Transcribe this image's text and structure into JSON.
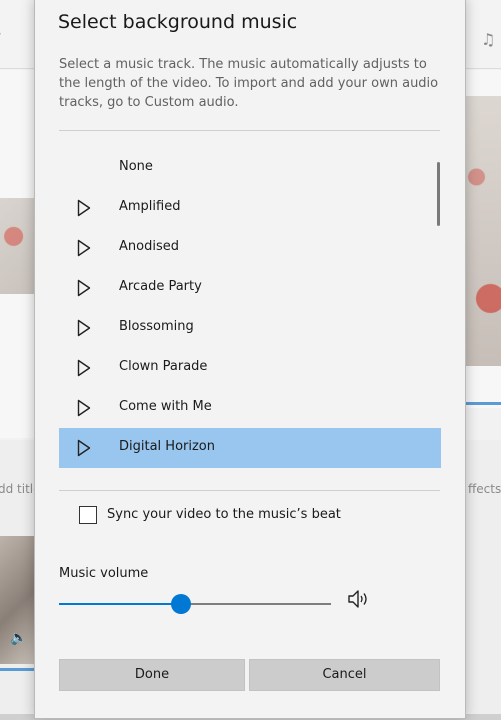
{
  "background": {
    "left_caption": "dd title",
    "right_caption": "ffects",
    "music_icon": "music-note-icon",
    "speaker_icon": "speaker-icon"
  },
  "dialog": {
    "title": "Select background music",
    "description": "Select a music track. The music automatically adjusts to the length of the video. To import and add your own audio tracks, go to Custom audio.",
    "tracks": [
      {
        "name": "None",
        "has_play": false,
        "selected": false
      },
      {
        "name": "Amplified",
        "has_play": true,
        "selected": false
      },
      {
        "name": "Anodised",
        "has_play": true,
        "selected": false
      },
      {
        "name": "Arcade Party",
        "has_play": true,
        "selected": false
      },
      {
        "name": "Blossoming",
        "has_play": true,
        "selected": false
      },
      {
        "name": "Clown Parade",
        "has_play": true,
        "selected": false
      },
      {
        "name": "Come with Me",
        "has_play": true,
        "selected": false
      },
      {
        "name": "Digital Horizon",
        "has_play": true,
        "selected": true
      }
    ],
    "sync": {
      "label": "Sync your video to the music’s beat",
      "checked": false
    },
    "volume": {
      "label": "Music volume",
      "level_percent": 45
    },
    "buttons": {
      "done": "Done",
      "cancel": "Cancel"
    },
    "colors": {
      "accent": "#0078d4",
      "selected_row": "#99c6ee"
    }
  }
}
